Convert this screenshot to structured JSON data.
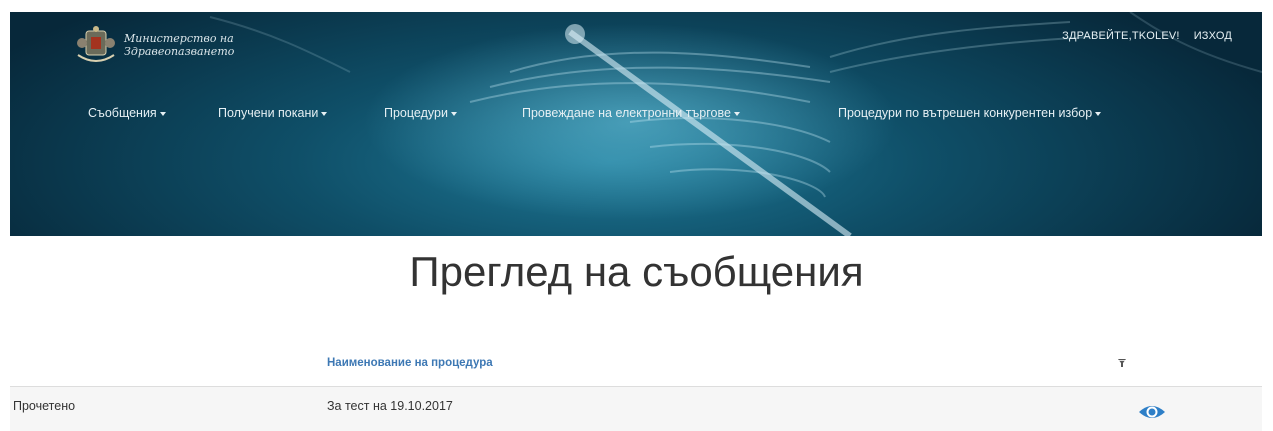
{
  "header": {
    "logo_line1": "Министерство на",
    "logo_line2": "Здравеопазването",
    "greeting": "ЗДРАВЕЙТЕ,TKOLEV!",
    "logout": "ИЗХОД"
  },
  "nav": {
    "items": [
      {
        "label": "Съобщения"
      },
      {
        "label": "Получени покани"
      },
      {
        "label": "Процедури"
      },
      {
        "label": "Провеждане на електронни търгове"
      },
      {
        "label": "Процедури по вътрешен конкурентен избор"
      }
    ]
  },
  "page": {
    "title": "Преглед на съобщения"
  },
  "table": {
    "columns": [
      "",
      "Наименование на процедура",
      ""
    ],
    "rows": [
      {
        "status": "Прочетено",
        "name": "За тест на 19.10.2017"
      }
    ]
  },
  "colors": {
    "accent": "#3d78b4",
    "eye": "#2e7fc7",
    "banner": "#0f4f68"
  },
  "icons": {
    "view": "eye-icon",
    "filter": "filter-icon",
    "logo": "crest-icon"
  }
}
